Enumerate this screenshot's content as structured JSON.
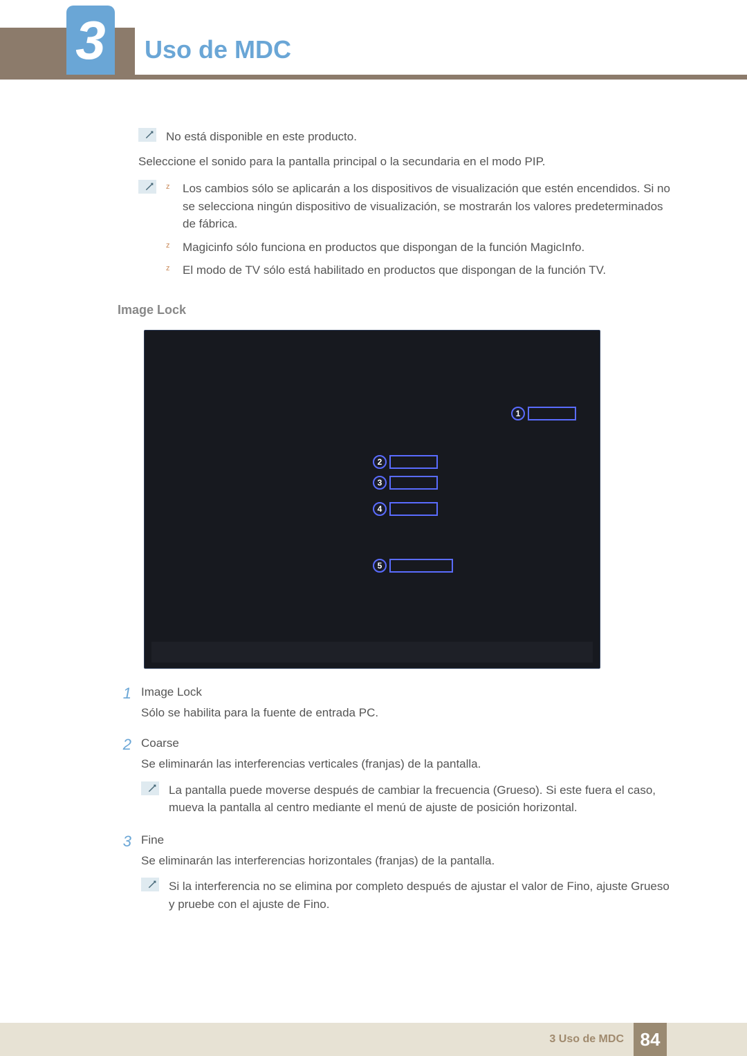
{
  "chapter": {
    "number": "3",
    "title": "Uso de MDC"
  },
  "notes": {
    "not_available": "No está disponible en este producto."
  },
  "paragraphs": {
    "select_sound": "Seleccione el sonido para la pantalla principal o la secundaria en el modo PIP."
  },
  "bullets": [
    "Los cambios sólo se aplicarán a los dispositivos de visualización que estén encendidos. Si no se selecciona ningún dispositivo de visualización, se mostrarán los valores predeterminados de fábrica.",
    "Magicinfo sólo funciona en productos que dispongan de la función MagicInfo.",
    "El modo de TV sólo está habilitado en productos que dispongan de la función TV."
  ],
  "section_heading": "Image Lock",
  "callouts": {
    "c1": "1",
    "c2": "2",
    "c3": "3",
    "c4": "4",
    "c5": "5"
  },
  "numbered": [
    {
      "n": "1",
      "title": "Image Lock",
      "desc": "Sólo se habilita para la fuente de entrada PC."
    },
    {
      "n": "2",
      "title": "Coarse",
      "desc": "Se eliminarán las interferencias verticales (franjas) de la pantalla.",
      "note": "La pantalla puede moverse después de cambiar la frecuencia (Grueso). Si este fuera el caso, mueva la pantalla al centro mediante el menú de ajuste de posición horizontal."
    },
    {
      "n": "3",
      "title": "Fine",
      "desc": "Se eliminarán las interferencias horizontales (franjas) de la pantalla.",
      "note": "Si la interferencia no se elimina por completo después de ajustar el valor de Fino, ajuste Grueso y pruebe con el ajuste de Fino."
    }
  ],
  "footer": {
    "label": "3 Uso de MDC",
    "page": "84"
  }
}
